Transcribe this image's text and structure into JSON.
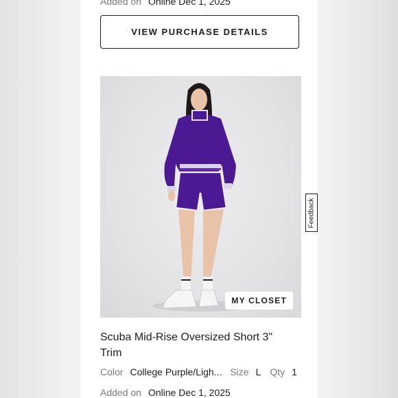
{
  "previous_order": {
    "added_label": "Added on",
    "added_value": "Online Dec 1, 2025",
    "view_button_label": "VIEW PURCHASE DETAILS"
  },
  "product": {
    "closet_badge": "MY CLOSET",
    "title": "Scuba Mid-Rise Oversized Short 3\" Trim",
    "color_label": "Color",
    "color_value": "College Purple/Ligh...",
    "size_label": "Size",
    "size_value": "L",
    "qty_label": "Qty",
    "qty_value": "1",
    "added_label": "Added on",
    "added_value": "Online Dec 1, 2025"
  },
  "feedback_tab": "Feedback",
  "colors": {
    "garment_purple": "#4b1a93",
    "text": "#1d1d1d",
    "muted": "#7a7a7a"
  }
}
